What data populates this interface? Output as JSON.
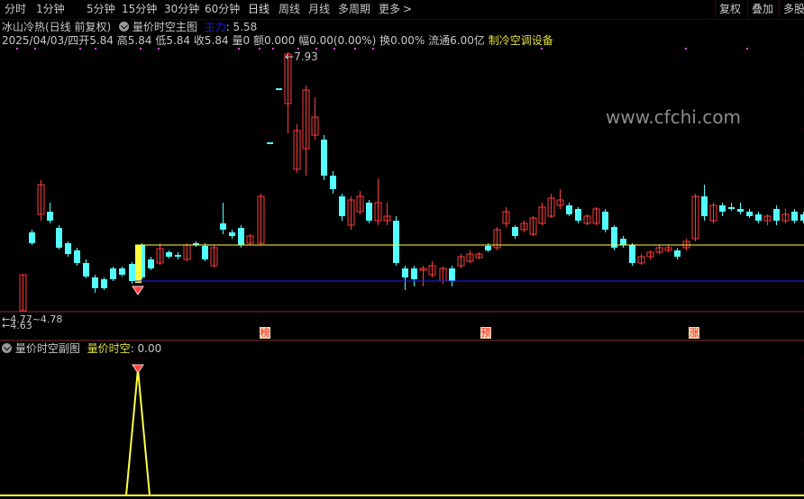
{
  "toolbar": {
    "tabs": [
      "分时",
      "1分钟",
      "5分钟",
      "15分钟",
      "30分钟",
      "60分钟",
      "日线",
      "周线",
      "月线",
      "多周期",
      "更多"
    ],
    "more_arrow": ">",
    "right_buttons": [
      "复权",
      "叠加",
      "多股"
    ]
  },
  "header": {
    "stock_title": "冰山冷热(日线 前复权)",
    "indicator_name": "量价时空主图",
    "indicator_value_label": "主力",
    "indicator_value": ": 5.58",
    "quote": {
      "date": "2025/04/03/四",
      "open": "开5.84",
      "high": "高5.84",
      "low": "低5.84",
      "close": "收5.84",
      "volume": "量0",
      "amount": "额0.000",
      "amplitude": "幅0.00(0.00%)",
      "turnover": "换0.00%",
      "float_cap": "流通6.00亿",
      "industry": "制冷空调设备"
    }
  },
  "main_chart": {
    "high_label": "7.93",
    "low_label": "4.63",
    "overlap_label": "4.77~4.78",
    "markers": [
      "榜",
      "预",
      "涨"
    ],
    "colors": {
      "up": "#ff3c3c",
      "down": "#54ffff",
      "yellow": "#ffff40",
      "blue": "#2020ff",
      "magenta": "#ff40ff",
      "grid": "#300000"
    }
  },
  "sub_chart": {
    "title": "量价时空副图",
    "series_label": "量价时空",
    "series_value": ": 0.00"
  },
  "watermark": "www.cfchi.com"
}
